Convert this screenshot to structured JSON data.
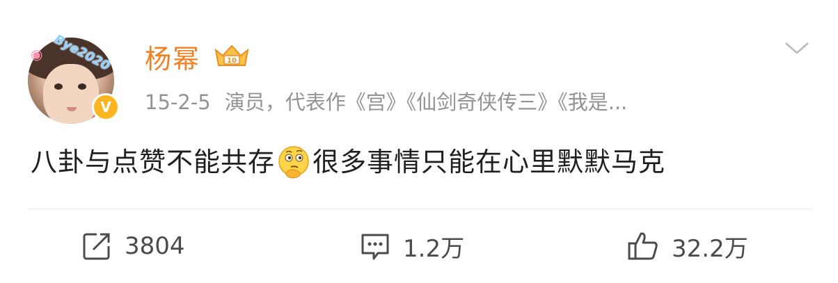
{
  "user": {
    "name": "杨幂",
    "avatar_overlay_text": "Bye2020",
    "verified_badge": "V"
  },
  "post": {
    "date": "15-2-5",
    "source": "演员，代表作《宫》《仙剑奇侠传三》《我是...",
    "text_before_emoji": "八卦与点赞不能共存",
    "emoji": "thinking-emoji",
    "text_after_emoji": "很多事情只能在心里默默马克"
  },
  "actions": {
    "repost_count": "3804",
    "comment_count": "1.2万",
    "like_count": "32.2万"
  },
  "icons": [
    "camera-icon",
    "crown-icon",
    "chevron-down-icon",
    "repost-icon",
    "comment-icon",
    "thumbs-up-icon"
  ],
  "colors": {
    "username": "#f08022",
    "meta": "#939393",
    "body_text": "#1f1f1f",
    "badge": "#fbb521",
    "action_icon": "#4b4b4b"
  }
}
